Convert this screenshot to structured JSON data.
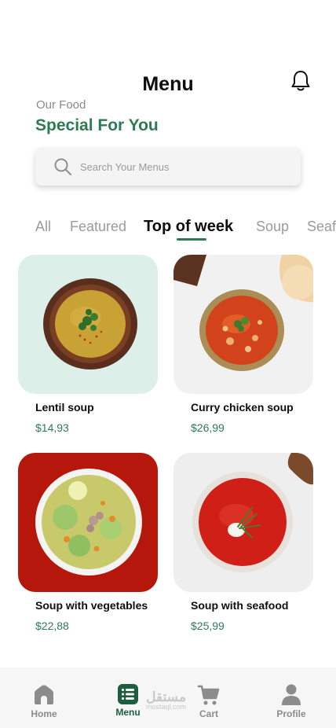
{
  "header": {
    "title": "Menu",
    "subtitle": "Our Food",
    "headline": "Special For You"
  },
  "search": {
    "placeholder": "Search Your Menus"
  },
  "categories": [
    {
      "label": "All",
      "active": false
    },
    {
      "label": "Featured",
      "active": false
    },
    {
      "label": "Top of week",
      "active": true
    },
    {
      "label": "Soup",
      "active": false
    },
    {
      "label": "Seafood",
      "active": false
    }
  ],
  "items": [
    {
      "name": "Lentil soup",
      "price": "$14,93"
    },
    {
      "name": "Curry chicken soup",
      "price": "$26,99"
    },
    {
      "name": "Soup with vegetables",
      "price": "$22,88"
    },
    {
      "name": "Soup with seafood",
      "price": "$25,99"
    }
  ],
  "nav": [
    {
      "label": "Home",
      "icon": "home-icon",
      "active": false
    },
    {
      "label": "Menu",
      "icon": "menu-list-icon",
      "active": true
    },
    {
      "label": "Cart",
      "icon": "cart-icon",
      "active": false
    },
    {
      "label": "Profile",
      "icon": "profile-icon",
      "active": false
    }
  ],
  "watermark": {
    "text": "مستقل",
    "sub": "mostaql.com"
  },
  "colors": {
    "accent": "#2e7a55",
    "nav_active": "#1d5e40",
    "muted": "#9b9b9b"
  }
}
